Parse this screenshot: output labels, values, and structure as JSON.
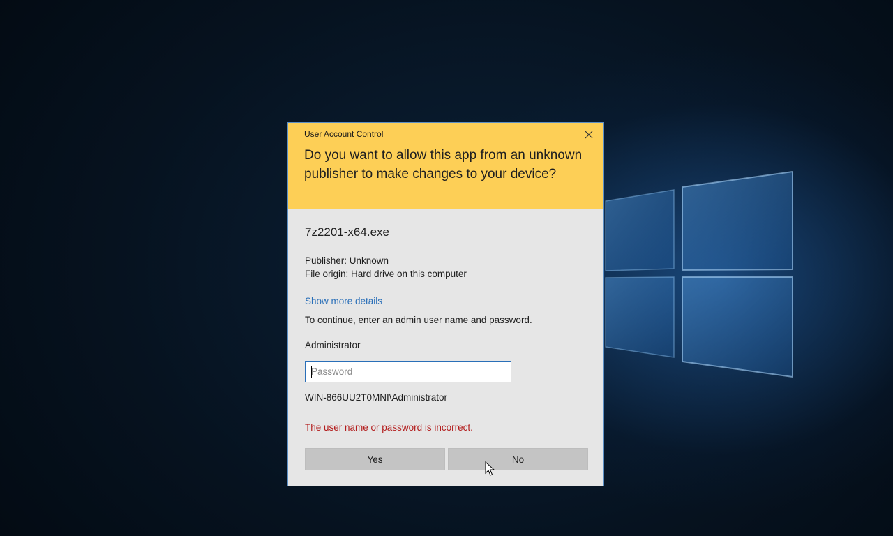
{
  "dialog": {
    "title": "User Account Control",
    "question": "Do you want to allow this app from an unknown publisher to make changes to your device?",
    "app_name": "7z2201-x64.exe",
    "publisher": "Publisher: Unknown",
    "file_origin": "File origin: Hard drive on this computer",
    "show_details_link": "Show more details",
    "instruction": "To continue, enter an admin user name and password.",
    "username": "Administrator",
    "password": {
      "placeholder": "Password",
      "value": ""
    },
    "account": "WIN-866UU2T0MNI\\Administrator",
    "error": "The user name or password is incorrect.",
    "yes_label": "Yes",
    "no_label": "No"
  },
  "colors": {
    "header": "#fdcf56",
    "body": "#e6e6e6",
    "link": "#2a6fb8",
    "error": "#b31d1d",
    "button": "#c4c4c4"
  },
  "icons": {
    "close": "close-icon",
    "cursor": "mouse-pointer-icon",
    "logo": "windows-logo"
  }
}
